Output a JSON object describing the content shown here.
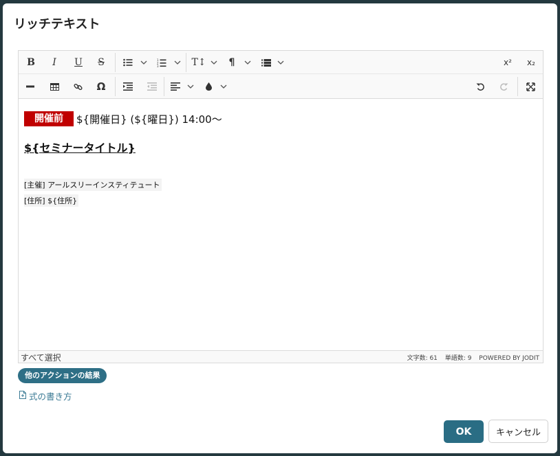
{
  "dialog": {
    "title": "リッチテキスト"
  },
  "toolbar": {
    "row1": [
      {
        "name": "bold",
        "icon": "bold-icon",
        "glyph": "B"
      },
      {
        "name": "italic",
        "icon": "italic-icon",
        "glyph": "I"
      },
      {
        "name": "underline",
        "icon": "underline-icon",
        "glyph": "U"
      },
      {
        "name": "strikethrough",
        "icon": "strikethrough-icon",
        "glyph": "S"
      },
      {
        "name": "bullet-list",
        "icon": "bullet-list-icon"
      },
      {
        "name": "numbered-list",
        "icon": "numbered-list-icon"
      },
      {
        "name": "font-size",
        "icon": "font-size-icon",
        "glyph": "T↕"
      },
      {
        "name": "paragraph",
        "icon": "paragraph-icon",
        "glyph": "¶"
      },
      {
        "name": "block-style",
        "icon": "block-style-icon"
      },
      {
        "name": "superscript",
        "icon": "superscript-icon",
        "glyph": "x²"
      },
      {
        "name": "subscript",
        "icon": "subscript-icon",
        "glyph": "x₂"
      }
    ],
    "row2": [
      {
        "name": "horizontal-rule",
        "icon": "horizontal-rule-icon"
      },
      {
        "name": "table",
        "icon": "table-icon"
      },
      {
        "name": "link",
        "icon": "link-icon"
      },
      {
        "name": "special-char",
        "icon": "omega-icon",
        "glyph": "Ω"
      },
      {
        "name": "indent",
        "icon": "indent-icon"
      },
      {
        "name": "outdent",
        "icon": "outdent-icon"
      },
      {
        "name": "align",
        "icon": "align-left-icon"
      },
      {
        "name": "color",
        "icon": "color-drop-icon"
      },
      {
        "name": "undo",
        "icon": "undo-icon"
      },
      {
        "name": "redo",
        "icon": "redo-icon"
      },
      {
        "name": "fullsize",
        "icon": "fullsize-icon"
      }
    ]
  },
  "content": {
    "badge": "開催前",
    "date_line": "${開催日} (${曜日}) 14:00〜",
    "seminar_title": "${セミナータイトル}",
    "host_line": "[主催] アールスリーインスティテュート",
    "address_line": "[住所] ${住所}"
  },
  "statusbar": {
    "select_all": "すべて選択",
    "char_count": "文字数: 61",
    "word_count": "単語数: 9",
    "powered_by": "POWERED BY JODIT"
  },
  "actions": {
    "other_action_chip": "他のアクションの結果",
    "formula_link": "式の書き方"
  },
  "footer": {
    "ok_label": "OK",
    "cancel_label": "キャンセル"
  },
  "colors": {
    "badge_bg": "#c00000",
    "primary": "#2a6d84",
    "backdrop": "#24393f"
  }
}
